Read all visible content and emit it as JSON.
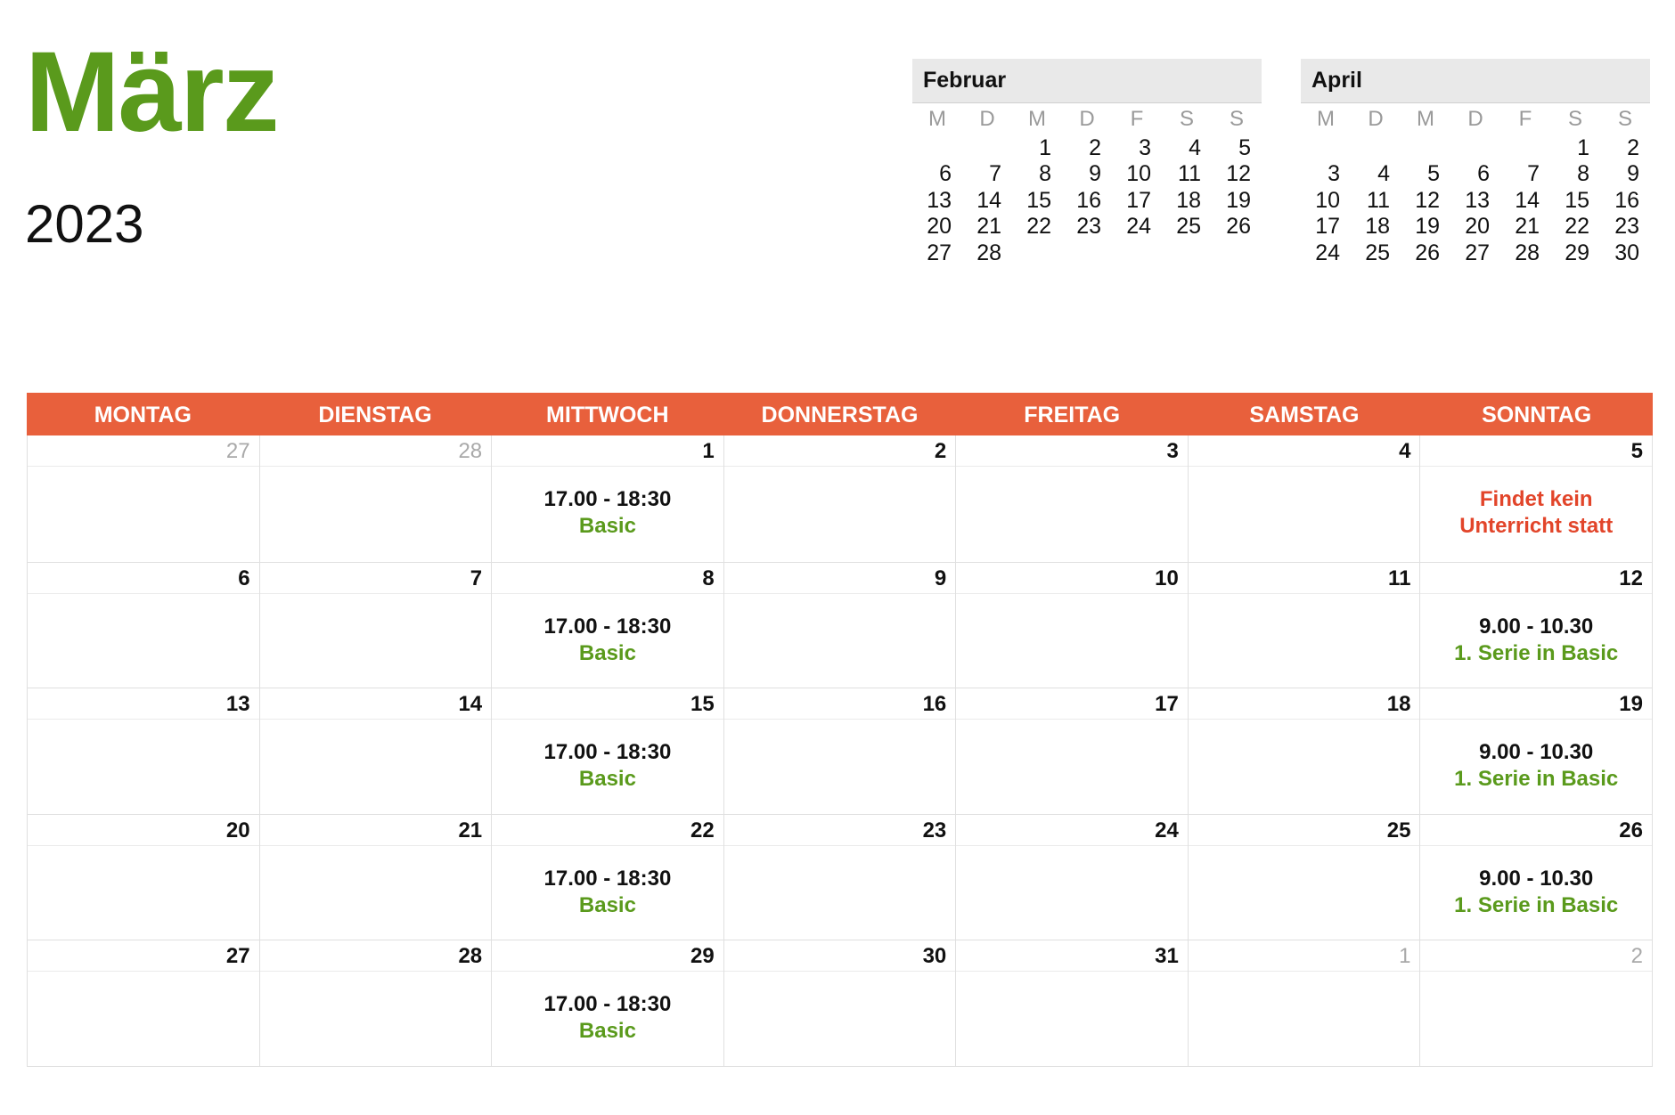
{
  "month_title": "März",
  "year": "2023",
  "mini_feb": {
    "title": "Februar",
    "weekdays": [
      "M",
      "D",
      "M",
      "D",
      "F",
      "S",
      "S"
    ],
    "days": [
      "",
      "",
      "1",
      "2",
      "3",
      "4",
      "5",
      "6",
      "7",
      "8",
      "9",
      "10",
      "11",
      "12",
      "13",
      "14",
      "15",
      "16",
      "17",
      "18",
      "19",
      "20",
      "21",
      "22",
      "23",
      "24",
      "25",
      "26",
      "27",
      "28",
      "",
      "",
      "",
      "",
      ""
    ]
  },
  "mini_apr": {
    "title": "April",
    "weekdays": [
      "M",
      "D",
      "M",
      "D",
      "F",
      "S",
      "S"
    ],
    "days": [
      "",
      "",
      "",
      "",
      "",
      "1",
      "2",
      "3",
      "4",
      "5",
      "6",
      "7",
      "8",
      "9",
      "10",
      "11",
      "12",
      "13",
      "14",
      "15",
      "16",
      "17",
      "18",
      "19",
      "20",
      "21",
      "22",
      "23",
      "24",
      "25",
      "26",
      "27",
      "28",
      "29",
      "30"
    ]
  },
  "weekday_headers": [
    "MONTAG",
    "DIENSTAG",
    "MITTWOCH",
    "DONNERSTAG",
    "FREITAG",
    "SAMSTAG",
    "SONNTAG"
  ],
  "weeks": [
    [
      {
        "day": "27",
        "out": true
      },
      {
        "day": "28",
        "out": true
      },
      {
        "day": "1",
        "time": "17.00 - 18:30",
        "label": "Basic"
      },
      {
        "day": "2"
      },
      {
        "day": "3"
      },
      {
        "day": "4"
      },
      {
        "day": "5",
        "note": [
          "Findet kein",
          "Unterricht statt"
        ]
      }
    ],
    [
      {
        "day": "6"
      },
      {
        "day": "7"
      },
      {
        "day": "8",
        "time": "17.00 - 18:30",
        "label": "Basic"
      },
      {
        "day": "9"
      },
      {
        "day": "10"
      },
      {
        "day": "11"
      },
      {
        "day": "12",
        "time": "9.00 - 10.30",
        "label": "1. Serie in Basic"
      }
    ],
    [
      {
        "day": "13"
      },
      {
        "day": "14"
      },
      {
        "day": "15",
        "time": "17.00 - 18:30",
        "label": "Basic"
      },
      {
        "day": "16"
      },
      {
        "day": "17"
      },
      {
        "day": "18"
      },
      {
        "day": "19",
        "time": "9.00 - 10.30",
        "label": "1. Serie in Basic"
      }
    ],
    [
      {
        "day": "20"
      },
      {
        "day": "21"
      },
      {
        "day": "22",
        "time": "17.00 - 18:30",
        "label": "Basic"
      },
      {
        "day": "23"
      },
      {
        "day": "24"
      },
      {
        "day": "25"
      },
      {
        "day": "26",
        "time": "9.00 - 10.30",
        "label": "1. Serie in Basic"
      }
    ],
    [
      {
        "day": "27"
      },
      {
        "day": "28"
      },
      {
        "day": "29",
        "time": "17.00 - 18:30",
        "label": "Basic"
      },
      {
        "day": "30"
      },
      {
        "day": "31"
      },
      {
        "day": "1",
        "out": true
      },
      {
        "day": "2",
        "out": true
      }
    ]
  ],
  "colors": {
    "accent_green": "#5a9a1c",
    "header_orange": "#e8603c",
    "note_red": "#e2452a"
  }
}
